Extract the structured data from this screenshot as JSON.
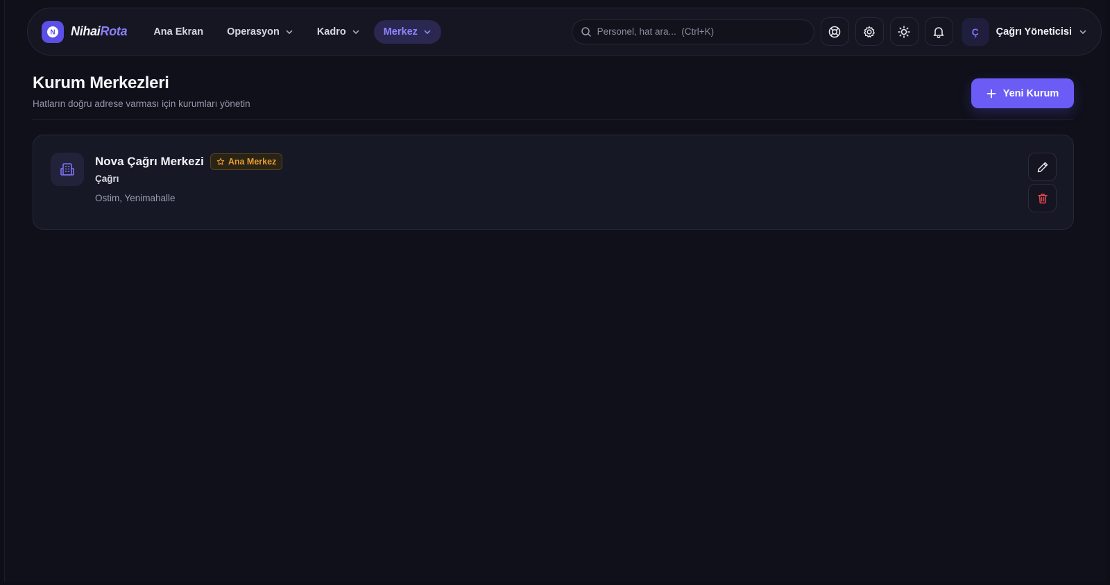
{
  "brand": {
    "name_part1": "Nihai",
    "name_part2": "Rota",
    "accent": "#6b5cf6",
    "badge_letter": "N"
  },
  "nav": [
    {
      "label": "Ana Ekran",
      "dropdown": false,
      "active": false
    },
    {
      "label": "Operasyon",
      "dropdown": true,
      "active": false
    },
    {
      "label": "Kadro",
      "dropdown": true,
      "active": false
    },
    {
      "label": "Merkez",
      "dropdown": true,
      "active": true
    }
  ],
  "search": {
    "placeholder": "Personel, hat ara...  (Ctrl+K)",
    "icon": "search-icon"
  },
  "toolbar": {
    "icons": [
      "help-lifebuoy-icon",
      "gear-icon",
      "sun-icon",
      "bell-icon"
    ]
  },
  "user": {
    "initial": "Ç",
    "name": "Çağrı Yöneticisi"
  },
  "page": {
    "title": "Kurum Merkezleri",
    "subtitle": "Hatların doğru adrese varması için kurumları yönetin",
    "new_button": "Yeni Kurum"
  },
  "centers": [
    {
      "name": "Nova Çağrı Merkezi",
      "badge": "Ana Merkez",
      "type": "Çağrı",
      "address": "Ostim, Yenimahalle",
      "icon": "building-icon"
    }
  ],
  "colors": {
    "background": "#0f101a",
    "card": "#171826",
    "badge_text": "#e79b2f",
    "danger": "#e5484d"
  }
}
